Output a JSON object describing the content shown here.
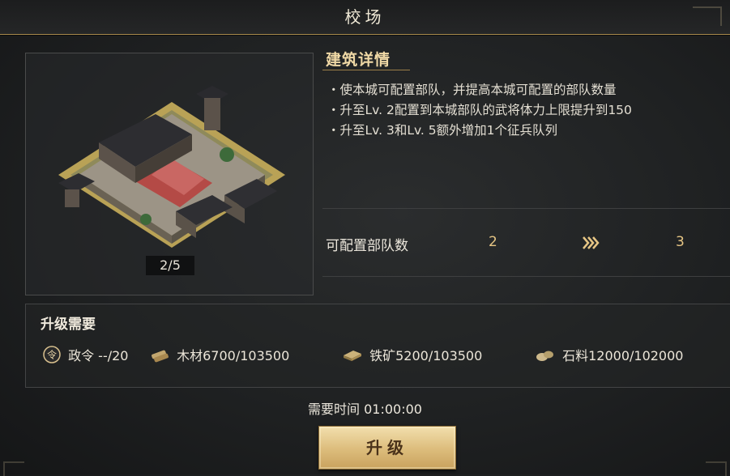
{
  "window": {
    "title": "校场"
  },
  "building": {
    "level_text": "2/5"
  },
  "details": {
    "header": "建筑详情",
    "lines": [
      "・使本城可配置部队，并提高本城可配置的部队数量",
      "・升至Lv. 2配置到本城部队的武将体力上限提升到150",
      "・升至Lv. 3和Lv. 5额外增加1个征兵队列"
    ]
  },
  "stat": {
    "label": "可配置部队数",
    "current": "2",
    "next": "3"
  },
  "requirements": {
    "title": "升级需要",
    "items": [
      {
        "icon": "decree-icon",
        "label": "政令 --/20"
      },
      {
        "icon": "wood-icon",
        "label": "木材6700/103500"
      },
      {
        "icon": "iron-icon",
        "label": "铁矿5200/103500"
      },
      {
        "icon": "stone-icon",
        "label": "石料12000/102000"
      }
    ]
  },
  "time": {
    "label": "需要时间 01:00:00"
  },
  "actions": {
    "upgrade_label": "升级"
  },
  "colors": {
    "accent_gold": "#e6c584",
    "button_gold": "#dcbc7b",
    "border_gold": "#a88a4c"
  }
}
